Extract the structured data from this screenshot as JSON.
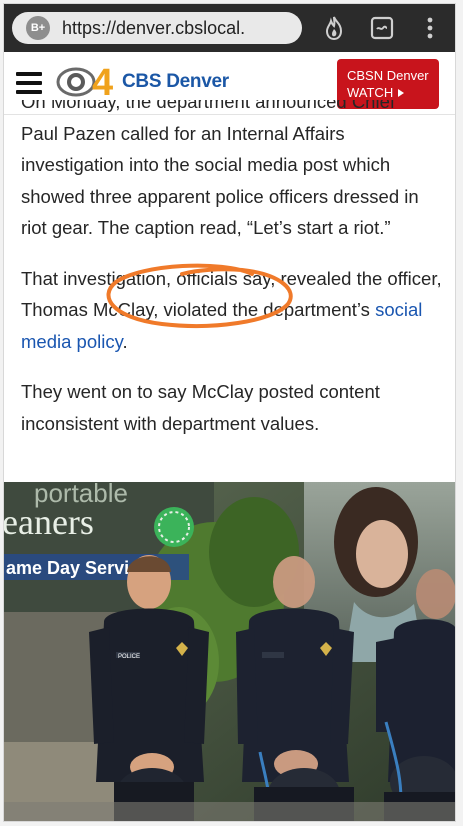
{
  "browser": {
    "tab_badge": "B+",
    "url": "https://denver.cbslocal.",
    "icons": [
      "flame-icon",
      "tab-switcher-icon",
      "overflow-menu-icon"
    ]
  },
  "site": {
    "logo_number": "4",
    "logo_text": "CBS Denver",
    "watch_line1": "CBSN Denver",
    "watch_line2": "WATCH",
    "brand_blue": "#1b57a6",
    "accent_red": "#c8141c"
  },
  "article": {
    "cut_line": "On Monday, the department announced Chief",
    "p1": "Paul Pazen called for an Internal Affairs investigation into the social media post which showed three apparent police officers dressed in riot gear. The caption read, “Let’s start a riot.”",
    "p2_before": "That investigation, officials say, revealed the officer, Thomas McClay, violated the department’s ",
    "p2_link": "social media policy",
    "p2_after": ".",
    "p3": "They went on to say McClay posted content inconsistent with department values."
  },
  "photo": {
    "sign_top": "portable",
    "sign_mid": "eaners",
    "sign_bottom": "ame Day Service",
    "patch": "POLICE"
  }
}
